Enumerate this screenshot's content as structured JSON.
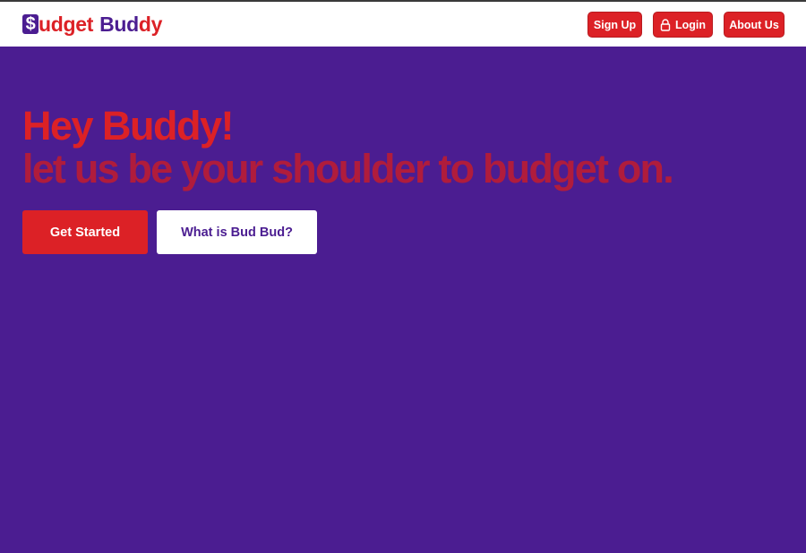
{
  "header": {
    "logo": {
      "badge": "$",
      "part1": "udget",
      "part2": "Bud",
      "part3": "dy"
    },
    "nav": {
      "signup_label": "Sign Up",
      "login_label": "Login",
      "about_label": "About Us"
    }
  },
  "hero": {
    "headline": "Hey Buddy!",
    "tagline": "let us be your shoulder to budget on.",
    "get_started_label": "Get Started",
    "what_is_label": "What is Bud Bud?"
  },
  "colors": {
    "brand_purple": "#4b1d91",
    "brand_red": "#dc2126",
    "tagline_red": "#b01c3c",
    "header_bg": "#ffffff"
  },
  "icons": {
    "login": "lock-icon"
  }
}
